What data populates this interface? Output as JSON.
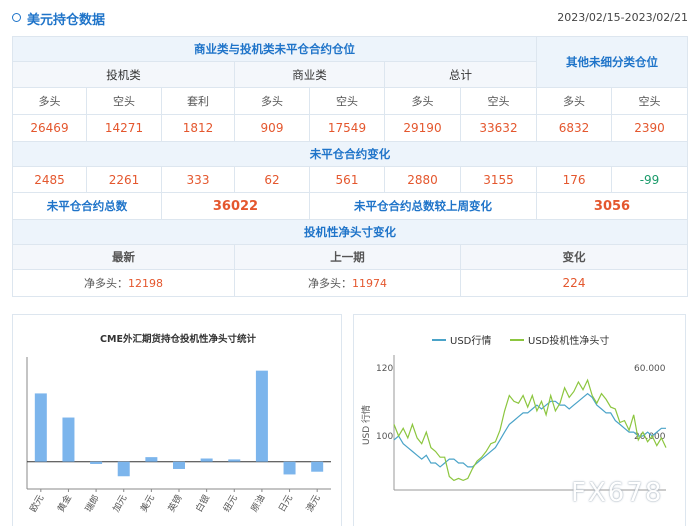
{
  "header": {
    "title": "美元持仓数据",
    "date_range": "2023/02/15-2023/02/21"
  },
  "table": {
    "group_title": "商业类与投机类未平仓合约仓位",
    "other_title": "其他未细分类仓位",
    "spec_label": "投机类",
    "comm_label": "商业类",
    "total_label": "总计",
    "col_labels": [
      "多头",
      "空头",
      "套利",
      "多头",
      "空头",
      "多头",
      "空头",
      "多头",
      "空头"
    ],
    "values": [
      "26469",
      "14271",
      "1812",
      "909",
      "17549",
      "29190",
      "33632",
      "6832",
      "2390"
    ],
    "change_title": "未平仓合约变化",
    "changes": [
      "2485",
      "2261",
      "333",
      "62",
      "561",
      "2880",
      "3155",
      "176",
      "-99"
    ],
    "oi_total_label": "未平仓合约总数",
    "oi_total_value": "36022",
    "oi_change_label": "未平仓合约总数较上周变化",
    "oi_change_value": "3056",
    "net_title": "投机性净头寸变化",
    "net_headers": [
      "最新",
      "上一期",
      "变化"
    ],
    "net_latest_label": "净多头：",
    "net_latest_value": "12198",
    "net_prev_label": "净多头：",
    "net_prev_value": "11974",
    "net_change": "224"
  },
  "colors": {
    "accent": "#1f74c9",
    "number": "#e4572e",
    "negative": "#1a9a6a",
    "bar": "#7cb5ec",
    "usd_line": "#4aa3c8",
    "spec_line": "#8cc63f"
  },
  "chart_data": [
    {
      "type": "bar",
      "title": "CME外汇期货持仓投机性净头寸统计",
      "categories": [
        "欧元",
        "黄金",
        "瑞郎",
        "加元",
        "美元",
        "英镑",
        "白银",
        "纽元",
        "原油",
        "日元",
        "澳元"
      ],
      "values": [
        150000,
        97000,
        -5000,
        -32000,
        10000,
        -16000,
        7000,
        5000,
        200000,
        -28000,
        -22000
      ],
      "ylim": [
        -60000,
        230000
      ]
    },
    {
      "type": "line",
      "legend_position": "top",
      "series": [
        {
          "name": "USD行情",
          "axis": "left",
          "values": [
            103,
            104,
            102,
            101,
            100,
            99,
            98,
            99,
            97,
            97,
            96,
            97,
            98,
            98,
            97,
            97,
            96,
            96,
            97,
            98,
            99,
            100,
            101,
            103,
            105,
            107,
            108,
            109,
            110,
            110,
            111,
            112,
            111,
            112,
            113,
            113,
            112,
            112,
            111,
            112,
            113,
            114,
            115,
            114,
            112,
            111,
            110,
            110,
            108,
            107,
            106,
            105,
            105,
            104,
            104,
            105,
            104,
            105,
            106,
            106
          ]
        },
        {
          "name": "USD投机性净头寸",
          "axis": "right",
          "values": [
            29000,
            23000,
            27000,
            22000,
            29000,
            22000,
            19000,
            25000,
            17000,
            15000,
            12000,
            12000,
            2000,
            0,
            1000,
            0,
            1000,
            6000,
            10000,
            12000,
            15000,
            19000,
            20000,
            26000,
            36000,
            44000,
            41000,
            40000,
            44000,
            38000,
            44000,
            36000,
            41000,
            34000,
            44000,
            36000,
            40000,
            48000,
            43000,
            46000,
            51000,
            47000,
            52000,
            44000,
            40000,
            45000,
            42000,
            38000,
            37000,
            30000,
            31000,
            26000,
            34000,
            21000,
            25000,
            20000,
            23000,
            18000,
            22000,
            17000
          ]
        }
      ],
      "y_left": {
        "label": "USD 行情",
        "ticks": [
          100,
          120
        ],
        "range": [
          90,
          125
        ]
      },
      "y_right": {
        "ticks": [
          "20.000",
          "60.000"
        ],
        "range": [
          -5000,
          65000
        ]
      },
      "grid": false
    }
  ],
  "watermark": "FX678"
}
